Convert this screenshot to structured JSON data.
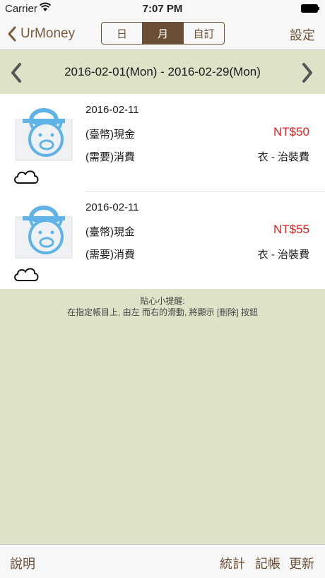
{
  "status_bar": {
    "carrier": "Carrier",
    "time": "7:07 PM"
  },
  "nav": {
    "back_label": "UrMoney",
    "segments": [
      "日",
      "月",
      "自訂"
    ],
    "selected_segment": "月",
    "settings_label": "設定"
  },
  "date_range": "2016-02-01(Mon) - 2016-02-29(Mon)",
  "entries": [
    {
      "date": "2016-02-11",
      "account": "(臺幣)現金",
      "amount": "NT$50",
      "type": "(需要)消費",
      "category": "衣 - 治裝費"
    },
    {
      "date": "2016-02-11",
      "account": "(臺幣)現金",
      "amount": "NT$55",
      "type": "(需要)消費",
      "category": "衣 - 治裝費"
    }
  ],
  "tip": {
    "title": "貼心小提醒:",
    "text": "在指定帳目上, 由左 而右的滑動, 將顯示 [刪除] 按鈕"
  },
  "toolbar": {
    "help_label": "說明",
    "stats_label": "統計",
    "record_label": "記帳",
    "update_label": "更新"
  },
  "colors": {
    "accent": "#6b4f35",
    "amount": "#e41e1e",
    "background": "#dfe2c7",
    "icon_blue": "#5fb3e6"
  }
}
